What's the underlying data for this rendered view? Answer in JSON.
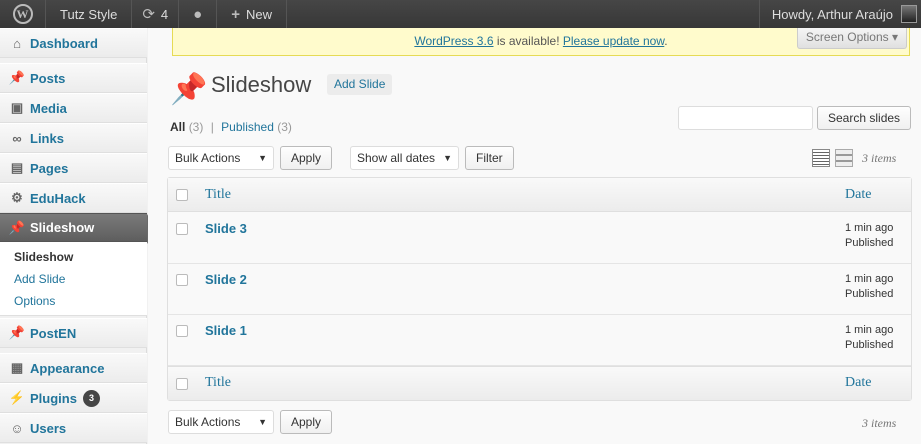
{
  "adminbar": {
    "site_name": "Tutz Style",
    "updates_count": "4",
    "new_label": "New",
    "howdy": "Howdy, Arthur Araújo"
  },
  "sidebar": {
    "items": [
      {
        "label": "Dashboard",
        "icon": "dashboard-icon"
      },
      {
        "label": "Posts",
        "icon": "pin-icon"
      },
      {
        "label": "Media",
        "icon": "media-icon"
      },
      {
        "label": "Links",
        "icon": "links-icon"
      },
      {
        "label": "Pages",
        "icon": "pages-icon"
      },
      {
        "label": "EduHack",
        "icon": "gear-icon"
      },
      {
        "label": "Slideshow",
        "icon": "pin-icon"
      },
      {
        "label": "PostEN",
        "icon": "pin-icon"
      },
      {
        "label": "Appearance",
        "icon": "appearance-icon"
      },
      {
        "label": "Plugins",
        "icon": "plugins-icon",
        "badge": "3"
      },
      {
        "label": "Users",
        "icon": "users-icon"
      }
    ],
    "submenu": [
      "Slideshow",
      "Add Slide",
      "Options"
    ]
  },
  "notice": {
    "link1": "WordPress 3.6",
    "mid": " is available! ",
    "link2": "Please update now",
    "end": "."
  },
  "screen_options": "Screen Options ▾",
  "page": {
    "title": "Slideshow",
    "add_new": "Add Slide"
  },
  "filters": {
    "all_label": "All",
    "all_count": "(3)",
    "sep": "|",
    "published_label": "Published",
    "published_count": "(3)"
  },
  "search_button": "Search slides",
  "bulk_actions": "Bulk Actions",
  "apply": "Apply",
  "dates": "Show all dates",
  "filter": "Filter",
  "items_count": "3 items",
  "table": {
    "col_title": "Title",
    "col_date": "Date",
    "rows": [
      {
        "title": "Slide 3",
        "date1": "1 min ago",
        "date2": "Published"
      },
      {
        "title": "Slide 2",
        "date1": "1 min ago",
        "date2": "Published"
      },
      {
        "title": "Slide 1",
        "date1": "1 min ago",
        "date2": "Published"
      }
    ]
  }
}
